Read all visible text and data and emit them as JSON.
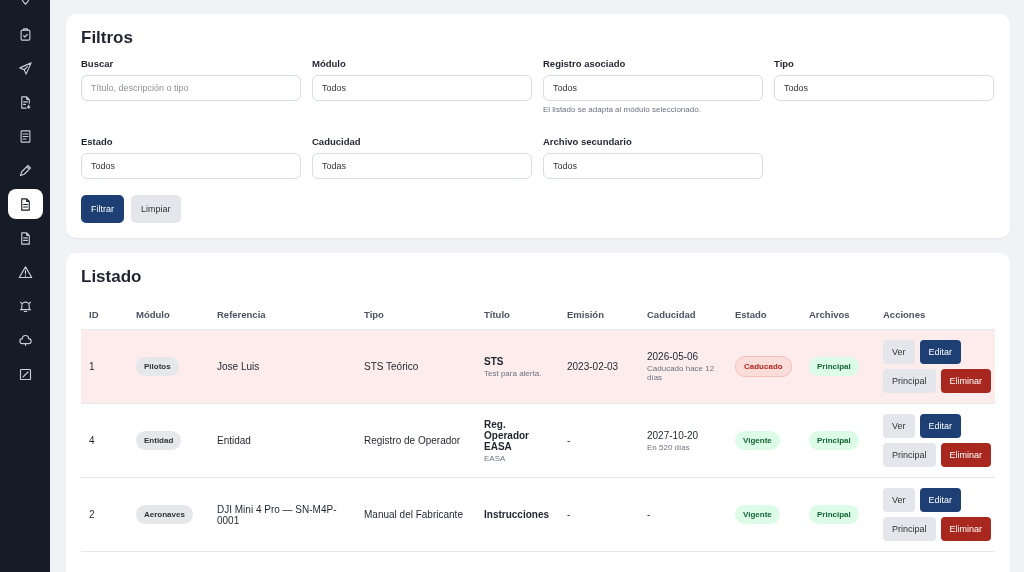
{
  "sidebar": {
    "items": [
      {
        "selected": false
      },
      {
        "selected": false
      },
      {
        "selected": false
      },
      {
        "selected": false
      },
      {
        "selected": false
      },
      {
        "selected": false
      },
      {
        "selected": true
      },
      {
        "selected": false
      },
      {
        "selected": false
      },
      {
        "selected": false
      },
      {
        "selected": false
      },
      {
        "selected": false
      }
    ]
  },
  "filters": {
    "title": "Filtros",
    "fields": [
      {
        "label": "Buscar",
        "placeholder": "Título, descripción o tipo"
      },
      {
        "label": "Módulo",
        "value": "Todos"
      },
      {
        "label": "Registro asociado",
        "value": "Todos",
        "hint": "El listado se adapta al módulo seleccionado."
      },
      {
        "label": "Tipo",
        "value": "Todos"
      },
      {
        "label": "Estado",
        "value": "Todos"
      },
      {
        "label": "Caducidad",
        "value": "Todas"
      },
      {
        "label": "Archivo secundario",
        "value": "Todos"
      }
    ],
    "buttons": [
      {
        "label": "Filtrar",
        "kind": "primary"
      },
      {
        "label": "Limpiar",
        "kind": "secondary"
      }
    ]
  },
  "listing": {
    "title": "Listado",
    "columns": [
      "ID",
      "Módulo",
      "Referencia",
      "Tipo",
      "Título",
      "Emisión",
      "Caducidad",
      "Estado",
      "Archivos",
      "Acciones"
    ],
    "rows": [
      {
        "id": "1",
        "module": "Pilotos",
        "reference": "Jose Luis",
        "type": "STS Teórico",
        "title": "STS",
        "subtitle": "Test para alerta.",
        "issued": "2023-02-03",
        "expiry": "2026-05-06",
        "expiry_note": "Caducado hace 12 días",
        "status": {
          "label": "Caducado",
          "kind": "expired"
        },
        "files": "Principal",
        "actions": [
          {
            "label": "Ver",
            "kind": "neutral"
          },
          {
            "label": "Editar",
            "kind": "primary"
          },
          {
            "label": "Principal",
            "kind": "neutral"
          },
          {
            "label": "Eliminar",
            "kind": "danger"
          }
        ]
      },
      {
        "id": "4",
        "module": "Entidad",
        "reference": "Entidad",
        "type": "Registro de Operador",
        "title": "Reg. Operador EASA",
        "subtitle": "EASA",
        "issued": "-",
        "expiry": "2027-10-20",
        "expiry_note": "En 520 días",
        "status": {
          "label": "Vigente",
          "kind": "valid"
        },
        "files": "Principal",
        "actions": [
          {
            "label": "Ver",
            "kind": "neutral"
          },
          {
            "label": "Editar",
            "kind": "primary"
          },
          {
            "label": "Principal",
            "kind": "neutral"
          },
          {
            "label": "Eliminar",
            "kind": "danger"
          }
        ]
      },
      {
        "id": "2",
        "module": "Aeronaves",
        "reference": "DJI Mini 4 Pro — SN-M4P-0001",
        "type": "Manual del Fabricante",
        "title": "Instrucciones",
        "issued": "-",
        "expiry": "-",
        "status": {
          "label": "Vigente",
          "kind": "valid"
        },
        "files": "Principal",
        "actions": [
          {
            "label": "Ver",
            "kind": "neutral"
          },
          {
            "label": "Editar",
            "kind": "primary"
          },
          {
            "label": "Principal",
            "kind": "neutral"
          },
          {
            "label": "Eliminar",
            "kind": "danger"
          }
        ]
      }
    ]
  }
}
